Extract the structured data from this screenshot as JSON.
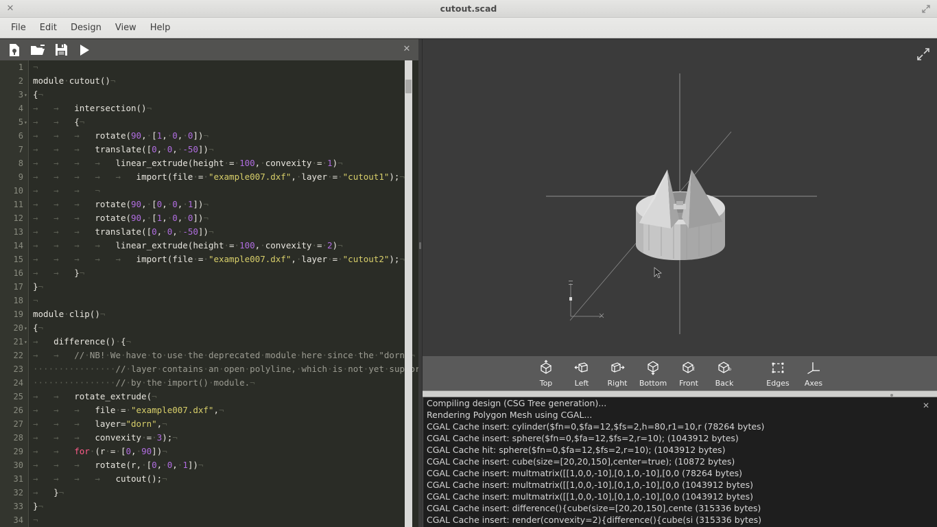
{
  "window": {
    "title": "cutout.scad",
    "close_icon": "close-icon",
    "maximize_icon": "maximize-icon"
  },
  "menubar": {
    "items": [
      {
        "label": "File"
      },
      {
        "label": "Edit"
      },
      {
        "label": "Design"
      },
      {
        "label": "View"
      },
      {
        "label": "Help"
      }
    ]
  },
  "editor": {
    "toolbar": {
      "new_icon": "new-file-icon",
      "open_icon": "open-folder-icon",
      "save_icon": "save-floppy-icon",
      "run_icon": "preview-play-icon",
      "close_icon": "close-icon"
    },
    "lines": [
      {
        "n": "1",
        "fold": "",
        "tabs": 0,
        "spaces": 0,
        "tokens": []
      },
      {
        "n": "2",
        "fold": "",
        "tabs": 0,
        "spaces": 0,
        "tokens": [
          {
            "t": "module cutout()",
            "c": "op"
          }
        ]
      },
      {
        "n": "3",
        "fold": "▾",
        "tabs": 0,
        "spaces": 0,
        "tokens": [
          {
            "t": "{",
            "c": "op"
          }
        ]
      },
      {
        "n": "4",
        "fold": "",
        "tabs": 2,
        "spaces": 0,
        "tokens": [
          {
            "t": "intersection()",
            "c": "op"
          }
        ]
      },
      {
        "n": "5",
        "fold": "▾",
        "tabs": 2,
        "spaces": 0,
        "tokens": [
          {
            "t": "{",
            "c": "op"
          }
        ]
      },
      {
        "n": "6",
        "fold": "",
        "tabs": 3,
        "spaces": 0,
        "tokens": [
          {
            "t": "rotate(",
            "c": "op"
          },
          {
            "t": "90",
            "c": "num"
          },
          {
            "t": ", [",
            "c": "op"
          },
          {
            "t": "1",
            "c": "num"
          },
          {
            "t": ", ",
            "c": "op"
          },
          {
            "t": "0",
            "c": "num"
          },
          {
            "t": ", ",
            "c": "op"
          },
          {
            "t": "0",
            "c": "num"
          },
          {
            "t": "])",
            "c": "op"
          }
        ]
      },
      {
        "n": "7",
        "fold": "",
        "tabs": 3,
        "spaces": 0,
        "tokens": [
          {
            "t": "translate([",
            "c": "op"
          },
          {
            "t": "0",
            "c": "num"
          },
          {
            "t": ", ",
            "c": "op"
          },
          {
            "t": "0",
            "c": "num"
          },
          {
            "t": ", ",
            "c": "op"
          },
          {
            "t": "-50",
            "c": "num"
          },
          {
            "t": "])",
            "c": "op"
          }
        ]
      },
      {
        "n": "8",
        "fold": "",
        "tabs": 4,
        "spaces": 0,
        "tokens": [
          {
            "t": "linear_extrude(height = ",
            "c": "op"
          },
          {
            "t": "100",
            "c": "num"
          },
          {
            "t": ", convexity = ",
            "c": "op"
          },
          {
            "t": "1",
            "c": "num"
          },
          {
            "t": ")",
            "c": "op"
          }
        ]
      },
      {
        "n": "9",
        "fold": "",
        "tabs": 5,
        "spaces": 0,
        "tokens": [
          {
            "t": "import(file = ",
            "c": "op"
          },
          {
            "t": "\"example007.dxf\"",
            "c": "str"
          },
          {
            "t": ", layer = ",
            "c": "op"
          },
          {
            "t": "\"cutout1\"",
            "c": "str"
          },
          {
            "t": ");",
            "c": "op"
          }
        ]
      },
      {
        "n": "10",
        "fold": "",
        "tabs": 3,
        "spaces": 0,
        "tokens": []
      },
      {
        "n": "11",
        "fold": "",
        "tabs": 3,
        "spaces": 0,
        "tokens": [
          {
            "t": "rotate(",
            "c": "op"
          },
          {
            "t": "90",
            "c": "num"
          },
          {
            "t": ", [",
            "c": "op"
          },
          {
            "t": "0",
            "c": "num"
          },
          {
            "t": ", ",
            "c": "op"
          },
          {
            "t": "0",
            "c": "num"
          },
          {
            "t": ", ",
            "c": "op"
          },
          {
            "t": "1",
            "c": "num"
          },
          {
            "t": "])",
            "c": "op"
          }
        ]
      },
      {
        "n": "12",
        "fold": "",
        "tabs": 3,
        "spaces": 0,
        "tokens": [
          {
            "t": "rotate(",
            "c": "op"
          },
          {
            "t": "90",
            "c": "num"
          },
          {
            "t": ", [",
            "c": "op"
          },
          {
            "t": "1",
            "c": "num"
          },
          {
            "t": ", ",
            "c": "op"
          },
          {
            "t": "0",
            "c": "num"
          },
          {
            "t": ", ",
            "c": "op"
          },
          {
            "t": "0",
            "c": "num"
          },
          {
            "t": "])",
            "c": "op"
          }
        ]
      },
      {
        "n": "13",
        "fold": "",
        "tabs": 3,
        "spaces": 0,
        "tokens": [
          {
            "t": "translate([",
            "c": "op"
          },
          {
            "t": "0",
            "c": "num"
          },
          {
            "t": ", ",
            "c": "op"
          },
          {
            "t": "0",
            "c": "num"
          },
          {
            "t": ", ",
            "c": "op"
          },
          {
            "t": "-50",
            "c": "num"
          },
          {
            "t": "])",
            "c": "op"
          }
        ]
      },
      {
        "n": "14",
        "fold": "",
        "tabs": 4,
        "spaces": 0,
        "tokens": [
          {
            "t": "linear_extrude(height = ",
            "c": "op"
          },
          {
            "t": "100",
            "c": "num"
          },
          {
            "t": ", convexity = ",
            "c": "op"
          },
          {
            "t": "2",
            "c": "num"
          },
          {
            "t": ")",
            "c": "op"
          }
        ]
      },
      {
        "n": "15",
        "fold": "",
        "tabs": 5,
        "spaces": 0,
        "tokens": [
          {
            "t": "import(file = ",
            "c": "op"
          },
          {
            "t": "\"example007.dxf\"",
            "c": "str"
          },
          {
            "t": ", layer = ",
            "c": "op"
          },
          {
            "t": "\"cutout2\"",
            "c": "str"
          },
          {
            "t": ");",
            "c": "op"
          }
        ]
      },
      {
        "n": "16",
        "fold": "",
        "tabs": 2,
        "spaces": 0,
        "tokens": [
          {
            "t": "}",
            "c": "op"
          }
        ]
      },
      {
        "n": "17",
        "fold": "",
        "tabs": 0,
        "spaces": 0,
        "tokens": [
          {
            "t": "}",
            "c": "op"
          }
        ]
      },
      {
        "n": "18",
        "fold": "",
        "tabs": 0,
        "spaces": 0,
        "tokens": []
      },
      {
        "n": "19",
        "fold": "",
        "tabs": 0,
        "spaces": 0,
        "tokens": [
          {
            "t": "module clip()",
            "c": "op"
          }
        ]
      },
      {
        "n": "20",
        "fold": "▾",
        "tabs": 0,
        "spaces": 0,
        "tokens": [
          {
            "t": "{",
            "c": "op"
          }
        ]
      },
      {
        "n": "21",
        "fold": "▾",
        "tabs": 1,
        "spaces": 0,
        "tokens": [
          {
            "t": "difference() {",
            "c": "op"
          }
        ]
      },
      {
        "n": "22",
        "fold": "",
        "tabs": 2,
        "spaces": 0,
        "tokens": [
          {
            "t": "// NB! We have to use the deprecated module here since the \"dorn\"",
            "c": "com"
          }
        ]
      },
      {
        "n": "23",
        "fold": "",
        "tabs": 0,
        "spaces": 16,
        "tokens": [
          {
            "t": "// layer contains an open polyline, which is not yet supported",
            "c": "com"
          }
        ]
      },
      {
        "n": "24",
        "fold": "",
        "tabs": 0,
        "spaces": 16,
        "tokens": [
          {
            "t": "// by the import() module.",
            "c": "com"
          }
        ]
      },
      {
        "n": "25",
        "fold": "",
        "tabs": 2,
        "spaces": 0,
        "tokens": [
          {
            "t": "rotate_extrude(",
            "c": "op"
          }
        ]
      },
      {
        "n": "26",
        "fold": "",
        "tabs": 3,
        "spaces": 0,
        "tokens": [
          {
            "t": "file = ",
            "c": "op"
          },
          {
            "t": "\"example007.dxf\"",
            "c": "str"
          },
          {
            "t": ",",
            "c": "op"
          }
        ]
      },
      {
        "n": "27",
        "fold": "",
        "tabs": 3,
        "spaces": 0,
        "tokens": [
          {
            "t": "layer=",
            "c": "op"
          },
          {
            "t": "\"dorn\"",
            "c": "str"
          },
          {
            "t": ",",
            "c": "op"
          }
        ]
      },
      {
        "n": "28",
        "fold": "",
        "tabs": 3,
        "spaces": 0,
        "tokens": [
          {
            "t": "convexity = ",
            "c": "op"
          },
          {
            "t": "3",
            "c": "num"
          },
          {
            "t": ");",
            "c": "op"
          }
        ]
      },
      {
        "n": "29",
        "fold": "",
        "tabs": 2,
        "spaces": 0,
        "tokens": [
          {
            "t": "for",
            "c": "kw"
          },
          {
            "t": " (r = [",
            "c": "op"
          },
          {
            "t": "0",
            "c": "num"
          },
          {
            "t": ", ",
            "c": "op"
          },
          {
            "t": "90",
            "c": "num"
          },
          {
            "t": "])",
            "c": "op"
          }
        ]
      },
      {
        "n": "30",
        "fold": "",
        "tabs": 3,
        "spaces": 0,
        "tokens": [
          {
            "t": "rotate(r, [",
            "c": "op"
          },
          {
            "t": "0",
            "c": "num"
          },
          {
            "t": ", ",
            "c": "op"
          },
          {
            "t": "0",
            "c": "num"
          },
          {
            "t": ", ",
            "c": "op"
          },
          {
            "t": "1",
            "c": "num"
          },
          {
            "t": "])",
            "c": "op"
          }
        ]
      },
      {
        "n": "31",
        "fold": "",
        "tabs": 4,
        "spaces": 0,
        "tokens": [
          {
            "t": "cutout();",
            "c": "op"
          }
        ]
      },
      {
        "n": "32",
        "fold": "",
        "tabs": 1,
        "spaces": 0,
        "tokens": [
          {
            "t": "}",
            "c": "op"
          }
        ]
      },
      {
        "n": "33",
        "fold": "",
        "tabs": 0,
        "spaces": 0,
        "tokens": [
          {
            "t": "}",
            "c": "op"
          }
        ]
      },
      {
        "n": "34",
        "fold": "",
        "tabs": 0,
        "spaces": 0,
        "tokens": []
      }
    ]
  },
  "viewport": {
    "expand_icon": "expand-arrows-icon",
    "background_color": "#3b3b3b",
    "model_color": "#cccccc"
  },
  "view_toolbar": {
    "buttons": [
      {
        "label": "Top",
        "icon": "cube-top-icon"
      },
      {
        "label": "Left",
        "icon": "cube-left-icon"
      },
      {
        "label": "Right",
        "icon": "cube-right-icon"
      },
      {
        "label": "Bottom",
        "icon": "cube-bottom-icon"
      },
      {
        "label": "Front",
        "icon": "cube-front-icon"
      },
      {
        "label": "Back",
        "icon": "cube-back-icon"
      }
    ],
    "toggles": [
      {
        "label": "Edges",
        "icon": "edges-icon"
      },
      {
        "label": "Axes",
        "icon": "axes-icon"
      }
    ]
  },
  "console": {
    "close_icon": "close-icon",
    "lines": [
      "Compiling design (CSG Tree generation)...",
      "Rendering Polygon Mesh using CGAL...",
      "CGAL Cache insert: cylinder($fn=0,$fa=12,$fs=2,h=80,r1=10,r (78264 bytes)",
      "CGAL Cache insert: sphere($fn=0,$fa=12,$fs=2,r=10); (1043912 bytes)",
      "CGAL Cache hit: sphere($fn=0,$fa=12,$fs=2,r=10); (1043912 bytes)",
      "CGAL Cache insert: cube(size=[20,20,150],center=true); (10872 bytes)",
      "CGAL Cache insert: multmatrix([[1,0,0,-10],[0,1,0,-10],[0,0 (78264 bytes)",
      "CGAL Cache insert: multmatrix([[1,0,0,-10],[0,1,0,-10],[0,0 (1043912 bytes)",
      "CGAL Cache insert: multmatrix([[1,0,0,-10],[0,1,0,-10],[0,0 (1043912 bytes)",
      "CGAL Cache insert: difference(){cube(size=[20,20,150],cente (315336 bytes)",
      "CGAL Cache insert: render(convexity=2){difference(){cube(si (315336 bytes)"
    ]
  }
}
